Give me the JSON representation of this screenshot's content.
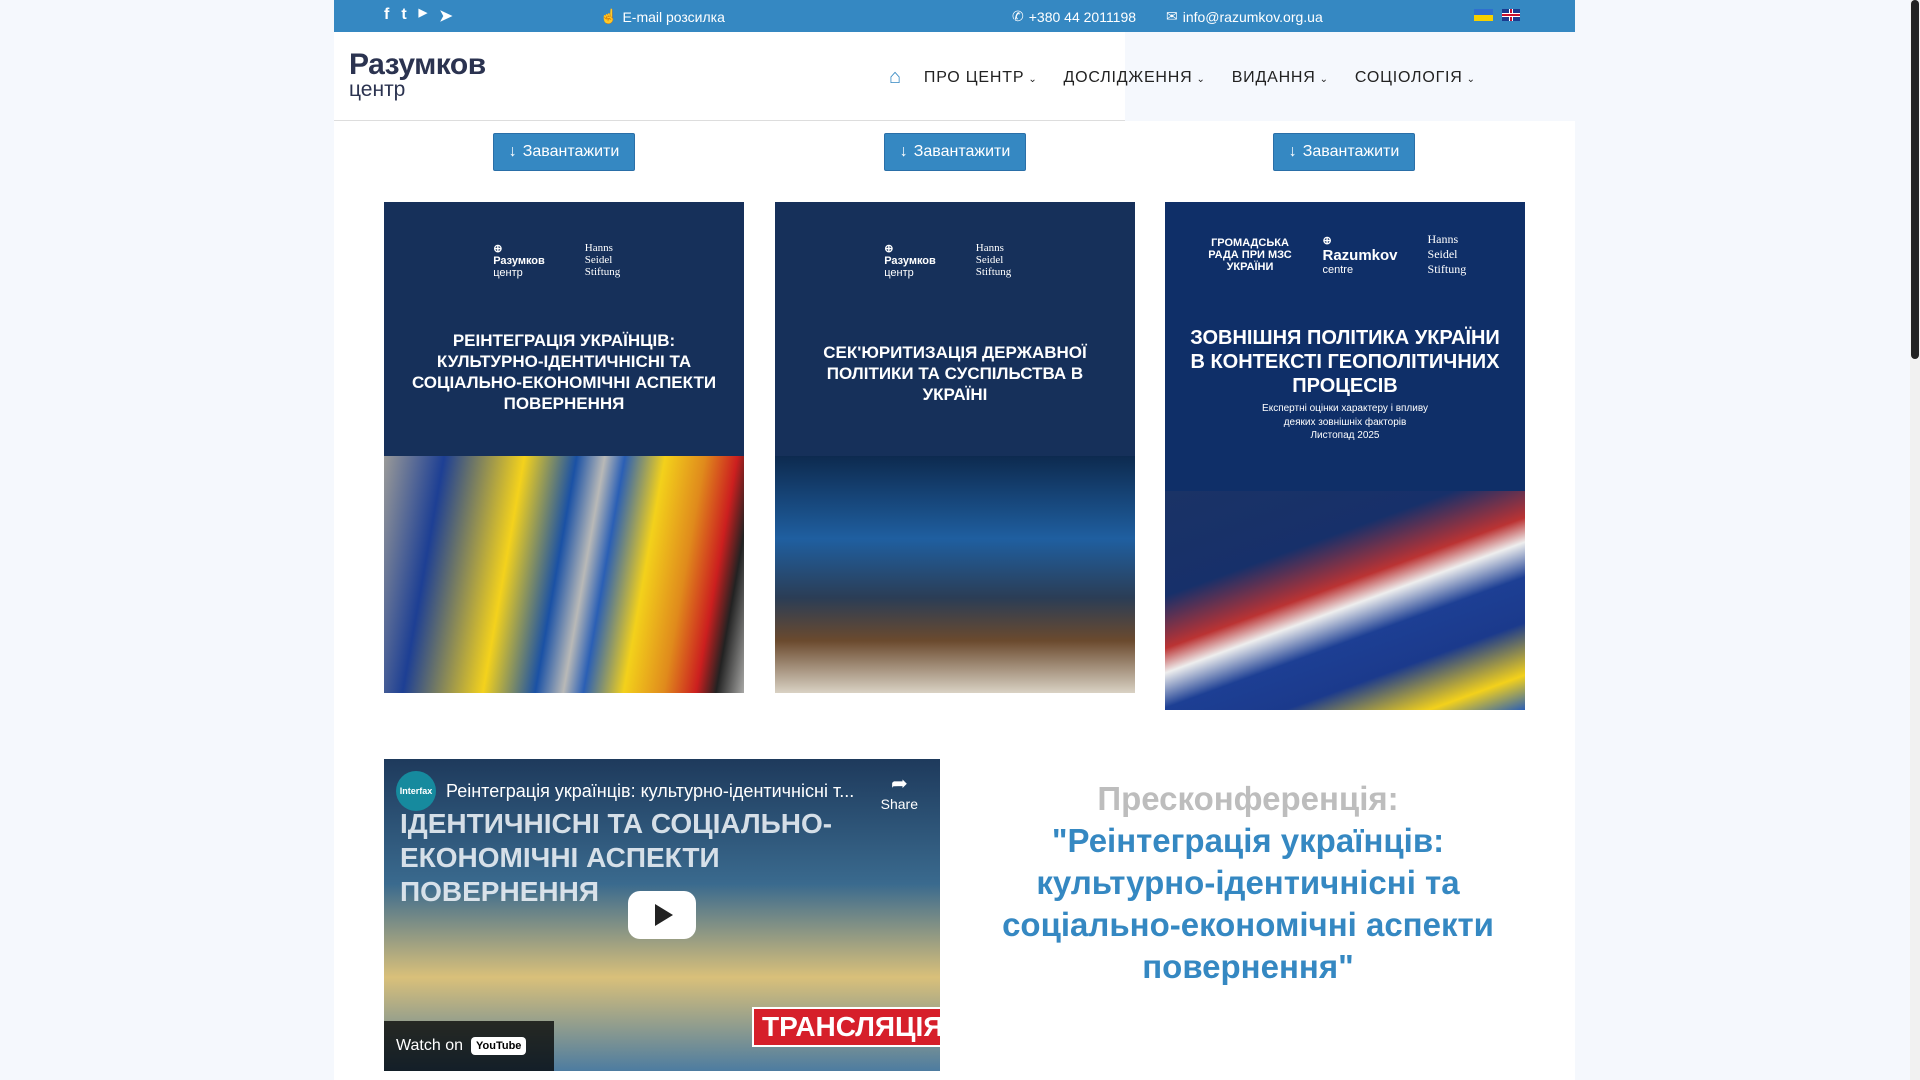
{
  "topbar": {
    "email_subscribe": "E-mail розсилка",
    "phone": "+380 44 2011198",
    "email": "info@razumkov.org.ua",
    "social": [
      "facebook-icon",
      "twitter-icon",
      "youtube-icon",
      "telegram-icon"
    ],
    "languages": [
      "UA",
      "EN"
    ]
  },
  "logo": {
    "line1": "Разумков",
    "line2": "центр"
  },
  "nav": {
    "items": [
      {
        "label": "ПРО ЦЕНТР"
      },
      {
        "label": "ДОСЛІДЖЕННЯ"
      },
      {
        "label": "ВИДАННЯ"
      },
      {
        "label": "СОЦІОЛОГІЯ"
      }
    ]
  },
  "download_label": "Завантажити",
  "covers": [
    {
      "org": "Разумков",
      "org_sub": "центр",
      "partner": "Hanns Seidel Stiftung",
      "title": "РЕІНТЕГРАЦІЯ УКРАЇНЦІВ: КУЛЬТУРНО-ІДЕНТИЧНІСНІ ТА СОЦІАЛЬНО-ЕКОНОМІЧНІ АСПЕКТИ ПОВЕРНЕННЯ"
    },
    {
      "org": "Разумков",
      "org_sub": "центр",
      "partner": "Hanns Seidel Stiftung",
      "title": "СЕК'ЮРИТИЗАЦІЯ ДЕРЖАВНОЇ ПОЛІТИКИ ТА СУСПІЛЬСТВА В УКРАЇНІ"
    },
    {
      "council": "ГРОМАДСЬКА РАДА ПРИ МЗС УКРАЇНИ",
      "org": "Razumkov",
      "org_sub": "centre",
      "partner": "Hanns Seidel Stiftung",
      "title": "ЗОВНІШНЯ ПОЛІТИКА УКРАЇНИ В КОНТЕКСТІ ГЕОПОЛІТИЧНИХ ПРОЦЕСІВ",
      "subtitle": "Експертні оцінки характеру і впливу деяких зовнішніх факторів",
      "date": "Листопад 2025"
    }
  ],
  "video": {
    "channel": "Interfax",
    "title": "Реінтеграція українців: культурно-ідентичнісні т...",
    "share": "Share",
    "thumb_text": "ІДЕНТИЧНІСНІ ТА СОЦІАЛЬНО-ЕКОНОМІЧНІ АСПЕКТИ ПОВЕРНЕННЯ",
    "watch_on": "Watch on",
    "youtube": "YouTube",
    "badge": "ТРАНСЛЯЦІЯ"
  },
  "press": {
    "label": "Пресконференція:",
    "title": "\"Реінтеграція українців: культурно-ідентичнісні та соціально-економічні аспекти повернення\""
  }
}
